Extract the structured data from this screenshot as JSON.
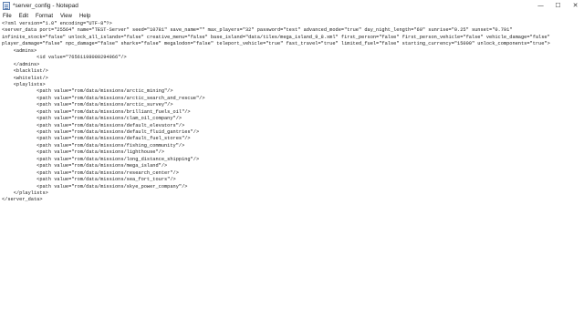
{
  "window": {
    "title": "*server_config - Notepad",
    "controls": {
      "minimize": "—",
      "maximize": "☐",
      "close": "✕"
    }
  },
  "menu": {
    "items": [
      "File",
      "Edit",
      "Format",
      "View",
      "Help"
    ]
  },
  "editor": {
    "lines": [
      "<?xml version=\"1.0\" encoding=\"UTF-8\"?>",
      "<server_data port=\"25564\" name=\"TEST-Server\" seed=\"10781\" save_name=\"\" max_players=\"32\" password=\"test\" advanced_mode=\"true\" day_night_length=\"60\" sunrise=\"0.25\" sunset=\"0.791\"",
      "infinite_stock=\"false\" unlock_all_islands=\"false\" creative_menu=\"false\" base_island=\"data/tiles/mega_island_9_8.xml\" first_person=\"false\" first_person_vehicle=\"false\" vehicle_damage=\"false\"",
      "player_damage=\"false\" npc_damage=\"false\" sharks=\"false\" megalodon=\"false\" teleport_vehicle=\"true\" fast_travel=\"true\" limited_fuel=\"false\" starting_currency=\"15000\" unlock_components=\"true\">",
      "    <admins>",
      "            <id value=\"76561198080294966\"/>",
      "    </admins>",
      "    <blacklist/>",
      "    <whitelist/>",
      "    <playlists>",
      "            <path value=\"rom/data/missions/arctic_mining\"/>",
      "            <path value=\"rom/data/missions/arctic_search_and_rescue\"/>",
      "            <path value=\"rom/data/missions/arctic_survey\"/>",
      "            <path value=\"rom/data/missions/brilliant_fuels_oil\"/>",
      "            <path value=\"rom/data/missions/clam_oil_company\"/>",
      "            <path value=\"rom/data/missions/default_elevators\"/>",
      "            <path value=\"rom/data/missions/default_fluid_gantries\"/>",
      "            <path value=\"rom/data/missions/default_fuel_stores\"/>",
      "            <path value=\"rom/data/missions/fishing_community\"/>",
      "            <path value=\"rom/data/missions/lighthouse\"/>",
      "            <path value=\"rom/data/missions/long_distance_shipping\"/>",
      "            <path value=\"rom/data/missions/mega_island\"/>",
      "            <path value=\"rom/data/missions/research_center\"/>",
      "            <path value=\"rom/data/missions/sea_fort_tours\"/>",
      "            <path value=\"rom/data/missions/skye_power_company\"/>",
      "    </playlists>",
      "</server_data>"
    ]
  }
}
